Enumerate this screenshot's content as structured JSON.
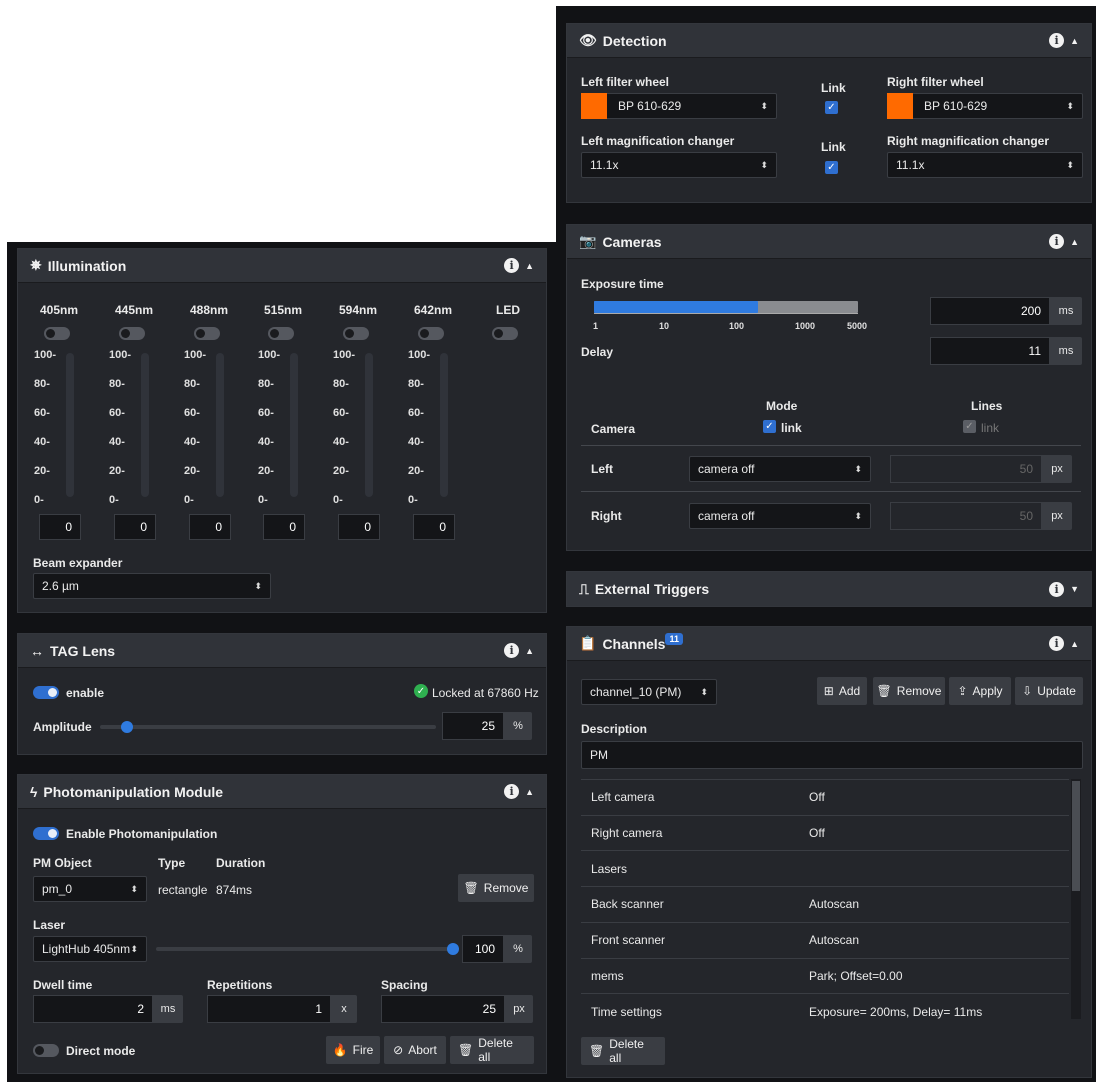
{
  "illumination": {
    "title": "Illumination",
    "channels": [
      {
        "label": "405nm",
        "value": "0"
      },
      {
        "label": "445nm",
        "value": "0"
      },
      {
        "label": "488nm",
        "value": "0"
      },
      {
        "label": "515nm",
        "value": "0"
      },
      {
        "label": "594nm",
        "value": "0"
      },
      {
        "label": "642nm",
        "value": "0"
      }
    ],
    "led_label": "LED",
    "ticks": [
      "100-",
      "80-",
      "60-",
      "40-",
      "20-",
      "0-"
    ],
    "beam_expander_label": "Beam expander",
    "beam_expander_value": "2.6 µm"
  },
  "tag_lens": {
    "title": "TAG Lens",
    "enable_label": "enable",
    "status": "Locked at 67860 Hz",
    "amplitude_label": "Amplitude",
    "amplitude_value": "25",
    "amplitude_unit": "%",
    "amplitude_fraction": 0.08
  },
  "pm": {
    "title": "Photomanipulation Module",
    "enable_label": "Enable Photomanipulation",
    "object_label": "PM Object",
    "type_label": "Type",
    "duration_label": "Duration",
    "object_value": "pm_0",
    "type_value": "rectangle",
    "duration_value": "874ms",
    "remove_label": "Remove",
    "laser_label": "Laser",
    "laser_value": "LightHub 405nm",
    "laser_power": "100",
    "laser_unit": "%",
    "laser_fraction": 1.0,
    "dwell_label": "Dwell time",
    "dwell_value": "2",
    "dwell_unit": "ms",
    "reps_label": "Repetitions",
    "reps_value": "1",
    "reps_unit": "x",
    "spacing_label": "Spacing",
    "spacing_value": "25",
    "spacing_unit": "px",
    "direct_label": "Direct mode",
    "fire_label": "Fire",
    "abort_label": "Abort",
    "delete_label": "Delete all"
  },
  "detection": {
    "title": "Detection",
    "left_fw_label": "Left filter wheel",
    "left_fw_value": "BP 610-629",
    "right_fw_label": "Right filter wheel",
    "right_fw_value": "BP 610-629",
    "link_label": "Link",
    "left_mag_label": "Left magnification changer",
    "left_mag_value": "11.1x",
    "right_mag_label": "Right magnification changer",
    "right_mag_value": "11.1x",
    "filter_color": "#ff6a00"
  },
  "cameras": {
    "title": "Cameras",
    "exposure_label": "Exposure time",
    "scale_ticks": [
      "1",
      "10",
      "100",
      "1000",
      "5000"
    ],
    "exposure_value": "200",
    "exposure_unit": "ms",
    "delay_label": "Delay",
    "delay_value": "11",
    "delay_unit": "ms",
    "mode_label": "Mode",
    "lines_label": "Lines",
    "camera_label": "Camera",
    "link_label": "link",
    "left_label": "Left",
    "right_label": "Right",
    "left_value": "camera off",
    "right_value": "camera off",
    "left_lines": "50",
    "right_lines": "50",
    "lines_unit": "px"
  },
  "triggers": {
    "title": "External Triggers"
  },
  "channels": {
    "title": "Channels",
    "count": "11",
    "selected": "channel_10 (PM)",
    "add_label": "Add",
    "remove_label": "Remove",
    "apply_label": "Apply",
    "update_label": "Update",
    "description_label": "Description",
    "description_value": "PM",
    "rows": [
      {
        "key": "Left camera",
        "value": "Off"
      },
      {
        "key": "Right camera",
        "value": "Off"
      },
      {
        "key": "Lasers",
        "value": ""
      },
      {
        "key": "Back scanner",
        "value": "Autoscan"
      },
      {
        "key": "Front scanner",
        "value": "Autoscan"
      },
      {
        "key": "mems",
        "value": "Park; Offset=0.00"
      },
      {
        "key": "Time settings",
        "value": "Exposure= 200ms, Delay= 11ms"
      }
    ],
    "delete_label": "Delete all"
  }
}
